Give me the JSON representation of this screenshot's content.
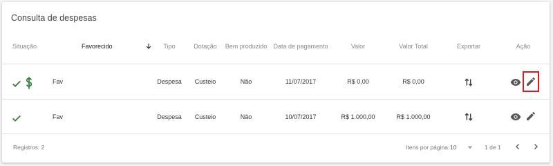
{
  "title": "Consulta de despesas",
  "columns": {
    "situacao": "Situação",
    "favorecido": "Favorecido",
    "tipo": "Tipo",
    "dotacao": "Dotação",
    "bem_produzido": "Bem produzido",
    "data_pagamento": "Data de pagamento",
    "valor": "Valor",
    "valor_total": "Valor Total",
    "exportar": "Exportar",
    "acao": "Ação"
  },
  "rows": [
    {
      "favorecido": "Fav",
      "tipo": "Despesa",
      "dotacao": "Custeio",
      "bem_produzido": "Não",
      "data_pagamento": "11/07/2017",
      "valor": "R$ 0,00",
      "valor_total": "R$ 0,00"
    },
    {
      "favorecido": "Fav",
      "tipo": "Despesa",
      "dotacao": "Custeio",
      "bem_produzido": "Não",
      "data_pagamento": "10/07/2017",
      "valor": "R$ 1.000,00",
      "valor_total": "R$ 1.000,00"
    }
  ],
  "footer": {
    "registros": "Registros: 2",
    "itens_por_pagina_label": "Itens por página:",
    "itens_por_pagina_value": "10",
    "page_range": "1 de 1"
  },
  "colors": {
    "check": "#2e7d32",
    "icon": "#555555",
    "highlight_border": "#e0181e"
  },
  "icons": [
    "check-icon",
    "dollar-icon",
    "sort-arrow-down-icon",
    "export-swap-icon",
    "eye-icon",
    "pencil-icon",
    "dropdown-arrow-icon",
    "chevron-left-icon",
    "chevron-right-icon"
  ]
}
